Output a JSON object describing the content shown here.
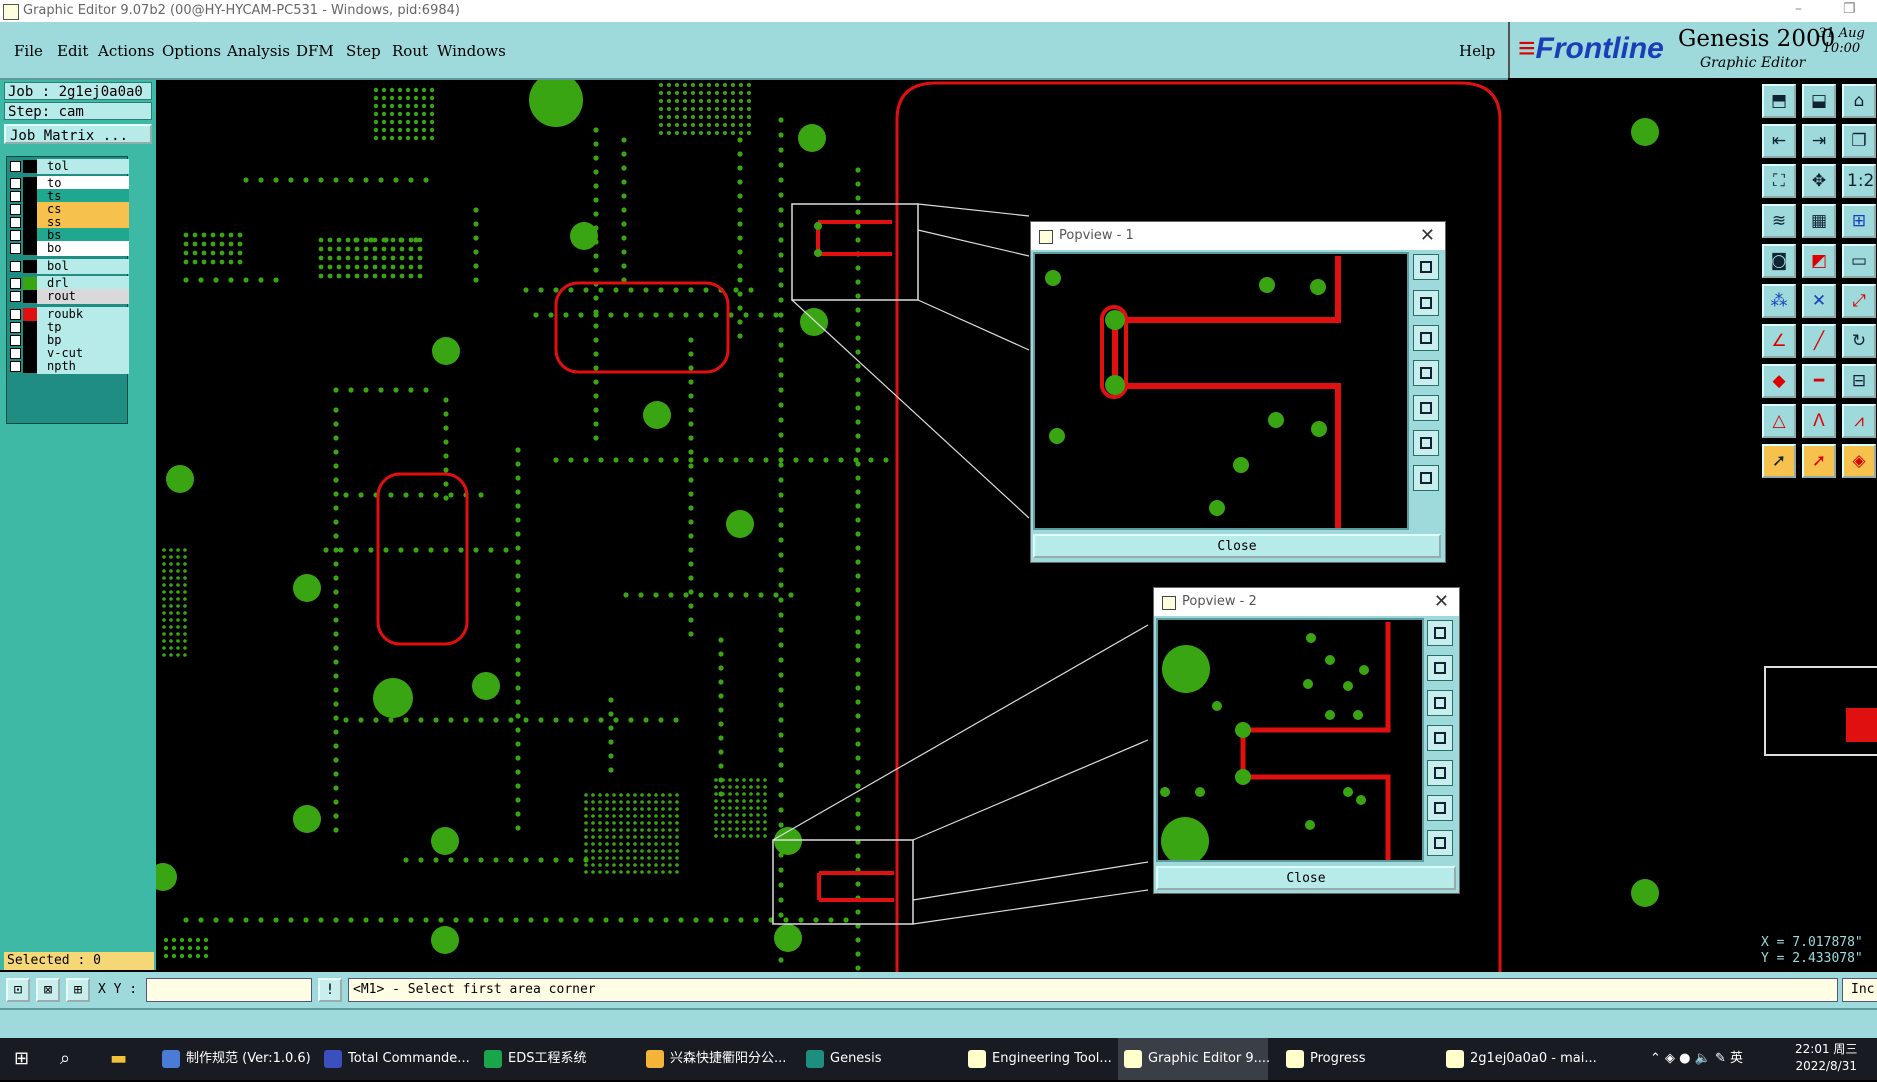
{
  "window": {
    "title": "Graphic Editor 9.07b2 (00@HY-HYCAM-PC531 - Windows, pid:6984)"
  },
  "menu": {
    "items": [
      "File",
      "Edit",
      "Actions",
      "Options",
      "Analysis",
      "DFM",
      "Step",
      "Rout",
      "Windows"
    ],
    "help": "Help"
  },
  "branding": {
    "logo": "Frontline",
    "product": "Genesis 2000",
    "subtitle": "Graphic Editor",
    "date_day": "31",
    "date_month": "Aug",
    "time": "10:00"
  },
  "job": {
    "job_label": "Job : 2g1ej0a0a0",
    "step_label": "Step: cam",
    "matrix_button": "Job Matrix ..."
  },
  "layers": [
    {
      "name": "tol",
      "color": "#000000",
      "bg": "#b7ebea"
    },
    {
      "name": "to",
      "color": "#000000",
      "bg": "#ffffff"
    },
    {
      "name": "ts",
      "color": "#000000",
      "bg": "#1fa88f"
    },
    {
      "name": "cs",
      "color": "#000000",
      "bg": "#f6c24d"
    },
    {
      "name": "ss",
      "color": "#000000",
      "bg": "#f6c24d"
    },
    {
      "name": "bs",
      "color": "#000000",
      "bg": "#1fa88f"
    },
    {
      "name": "bo",
      "color": "#000000",
      "bg": "#ffffff"
    },
    {
      "name": "bol",
      "color": "#000000",
      "bg": "#b7ebea"
    },
    {
      "name": "drl",
      "color": "#3aa512",
      "bg": "#b7ebea"
    },
    {
      "name": "rout",
      "color": "#000000",
      "bg": "#d9d9d9"
    },
    {
      "name": "roubk",
      "color": "#e01010",
      "bg": "#b7ebea"
    },
    {
      "name": "tp",
      "color": "#000000",
      "bg": "#b7ebea"
    },
    {
      "name": "bp",
      "color": "#000000",
      "bg": "#b7ebea"
    },
    {
      "name": "v-cut",
      "color": "#000000",
      "bg": "#b7ebea"
    },
    {
      "name": "npth",
      "color": "#000000",
      "bg": "#b7ebea"
    }
  ],
  "selected_label": "Selected : 0",
  "popview1": {
    "title": "Popview - 1",
    "close": "Close"
  },
  "popview2": {
    "title": "Popview - 2",
    "close": "Close"
  },
  "coords": {
    "x": "X = 7.017878\"",
    "y": "Y = 2.433078\""
  },
  "command": {
    "xy_label": "X Y :",
    "xy_value": "",
    "prompt": "<M1> - Select first area corner",
    "inc": "Inc"
  },
  "taskbar": {
    "apps": [
      {
        "label": "制作规范 (Ver:1.0.6)",
        "color": "#4a7bd6"
      },
      {
        "label": "Total Commande...",
        "color": "#3b4fbf"
      },
      {
        "label": "EDS工程系统",
        "color": "#1aa54a"
      },
      {
        "label": "兴森快捷衢阳分公...",
        "color": "#f3b43a"
      },
      {
        "label": "Genesis",
        "color": "#1d8f7e"
      },
      {
        "label": "Engineering Tool...",
        "color": "#ffffcc"
      },
      {
        "label": "Graphic Editor 9....",
        "color": "#ffffcc"
      },
      {
        "label": "Progress",
        "color": "#ffffcc"
      },
      {
        "label": "2g1ej0a0a0 - mai...",
        "color": "#ffffcc"
      }
    ],
    "tray": "英",
    "time": "22:01 周三",
    "date": "2022/8/31"
  },
  "colors": {
    "pad": "#3aa512",
    "rout": "#e01010",
    "panel": "#9ed9dc"
  }
}
